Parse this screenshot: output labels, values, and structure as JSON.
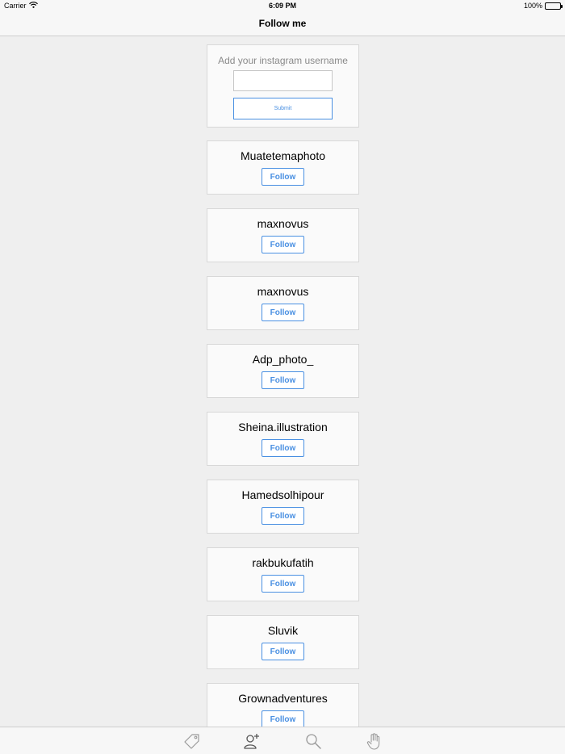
{
  "status_bar": {
    "carrier": "Carrier",
    "time": "6:09 PM",
    "battery": "100%"
  },
  "nav": {
    "title": "Follow me"
  },
  "add_form": {
    "label": "Add your instagram username",
    "input_value": "",
    "submit_label": "Submit"
  },
  "users": [
    {
      "name": "Muatetemaphoto",
      "button": "Follow"
    },
    {
      "name": "maxnovus",
      "button": "Follow"
    },
    {
      "name": "maxnovus",
      "button": "Follow"
    },
    {
      "name": "Adp_photo_",
      "button": "Follow"
    },
    {
      "name": "Sheina.illustration",
      "button": "Follow"
    },
    {
      "name": "Hamedsolhipour",
      "button": "Follow"
    },
    {
      "name": "rakbukufatih",
      "button": "Follow"
    },
    {
      "name": "Sluvik",
      "button": "Follow"
    },
    {
      "name": "Grownadventures",
      "button": "Follow"
    }
  ],
  "tab_bar": {
    "items": [
      "tag-icon",
      "add-user-icon",
      "search-icon",
      "hand-icon"
    ],
    "active": "add-user-icon"
  },
  "colors": {
    "accent": "#4a90e2",
    "background": "#efefef",
    "card": "#fafafa",
    "active_tab": "#555555",
    "inactive_tab": "#9a9a9a"
  }
}
